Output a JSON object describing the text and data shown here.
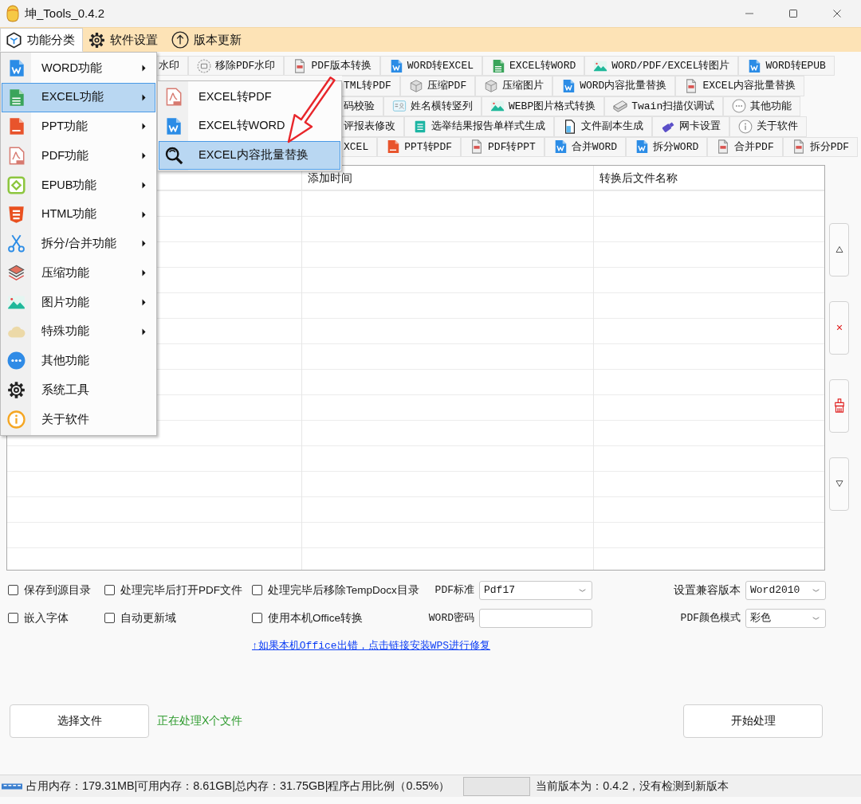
{
  "window": {
    "title": "坤_Tools_0.4.2"
  },
  "menu_bar": [
    {
      "label": "功能分类",
      "kind": "category",
      "selected": true
    },
    {
      "label": "软件设置",
      "kind": "settings",
      "selected": false
    },
    {
      "label": "版本更新",
      "kind": "update",
      "selected": false
    }
  ],
  "category_menu": {
    "items": [
      {
        "label": "WORD功能",
        "kind": "word",
        "has_submenu": true,
        "selected": false
      },
      {
        "label": "EXCEL功能",
        "kind": "excel",
        "has_submenu": true,
        "selected": true,
        "children": [
          {
            "label": "EXCEL转PDF",
            "kind": "pdf",
            "selected": false
          },
          {
            "label": "EXCEL转WORD",
            "kind": "word",
            "selected": false
          },
          {
            "label": "EXCEL内容批量替换",
            "kind": "replace",
            "selected": true
          }
        ]
      },
      {
        "label": "PPT功能",
        "kind": "ppt",
        "has_submenu": true,
        "selected": false
      },
      {
        "label": "PDF功能",
        "kind": "pdf",
        "has_submenu": true,
        "selected": false
      },
      {
        "label": "EPUB功能",
        "kind": "epub",
        "has_submenu": true,
        "selected": false
      },
      {
        "label": "HTML功能",
        "kind": "html",
        "has_submenu": true,
        "selected": false
      },
      {
        "label": "拆分/合并功能",
        "kind": "split",
        "has_submenu": true,
        "selected": false
      },
      {
        "label": "压缩功能",
        "kind": "compress",
        "has_submenu": true,
        "selected": false
      },
      {
        "label": "图片功能",
        "kind": "image",
        "has_submenu": true,
        "selected": false
      },
      {
        "label": "特殊功能",
        "kind": "special",
        "has_submenu": true,
        "selected": false
      },
      {
        "label": "其他功能",
        "kind": "other",
        "has_submenu": false,
        "selected": false
      },
      {
        "label": "系统工具",
        "kind": "system",
        "has_submenu": false,
        "selected": false
      },
      {
        "label": "关于软件",
        "kind": "about",
        "has_submenu": false,
        "selected": false
      }
    ]
  },
  "toolbar_rows": [
    [
      {
        "label": "水印"
      },
      {
        "label": "移除PDF水印",
        "kind": "watermark"
      },
      {
        "label": "PDF版本转换",
        "kind": "graydoc"
      },
      {
        "label": "WORD转EXCEL",
        "kind": "word"
      },
      {
        "label": "EXCEL转WORD",
        "kind": "excel"
      },
      {
        "label": "WORD/PDF/EXCEL转图片",
        "kind": "image"
      },
      {
        "label": "WORD转EPUB",
        "kind": "word"
      }
    ],
    [
      {
        "label": "TML转PDF"
      },
      {
        "label": "压缩PDF",
        "kind": "box"
      },
      {
        "label": "压缩图片",
        "kind": "box"
      },
      {
        "label": "WORD内容批量替换",
        "kind": "word"
      },
      {
        "label": "EXCEL内容批量替换",
        "kind": "graydoc"
      }
    ],
    [
      {
        "label": "码校验"
      },
      {
        "label": "姓名横转竖列",
        "kind": "card"
      },
      {
        "label": "WEBP图片格式转换",
        "kind": "image"
      },
      {
        "label": "Twain扫描仪调试",
        "kind": "scanner"
      },
      {
        "label": "其他功能",
        "kind": "moreline"
      }
    ],
    [
      {
        "label": "评报表修改"
      },
      {
        "label": "选举结果报告单样式生成",
        "kind": "tealdoc"
      },
      {
        "label": "文件副本生成",
        "kind": "file"
      },
      {
        "label": "网卡设置",
        "kind": "usb"
      },
      {
        "label": "关于软件",
        "kind": "infoline"
      }
    ],
    [
      {
        "label": "XCEL"
      },
      {
        "label": "PPT转PDF",
        "kind": "ppt"
      },
      {
        "label": "PDF转PPT",
        "kind": "graydoc"
      },
      {
        "label": "合并WORD",
        "kind": "word"
      },
      {
        "label": "拆分WORD",
        "kind": "word"
      },
      {
        "label": "合并PDF",
        "kind": "graydoc"
      },
      {
        "label": "拆分PDF",
        "kind": "graydoc"
      }
    ]
  ],
  "file_table": {
    "columns": [
      {},
      {
        "heading": "添加时间"
      },
      {
        "heading": "转换后文件名称"
      }
    ]
  },
  "side_buttons": [
    {
      "kind": "move_up"
    },
    {
      "kind": "remove"
    },
    {
      "kind": "clear"
    },
    {
      "kind": "move_down"
    }
  ],
  "options": [
    [
      {
        "kind": "checkbox",
        "label": "保存到源目录",
        "checked": false
      },
      {
        "kind": "checkbox",
        "label": "处理完毕后打开PDF文件",
        "checked": false
      },
      {
        "kind": "checkbox",
        "label": "处理完毕后移除TempDocx目录",
        "checked": false
      },
      {
        "kind": "select",
        "label": "PDF标准",
        "value": "Pdf17"
      },
      {
        "kind": "select",
        "label": "设置兼容版本",
        "value": "Word2010"
      }
    ],
    [
      {
        "kind": "checkbox",
        "label": "嵌入字体",
        "checked": false
      },
      {
        "kind": "checkbox",
        "label": "自动更新域",
        "checked": false
      },
      {
        "kind": "checkbox",
        "label": "使用本机Office转换",
        "checked": false
      },
      {
        "kind": "input",
        "label": "WORD密码"
      },
      {
        "kind": "select",
        "label": "PDF颜色模式",
        "value": "彩色"
      }
    ]
  ],
  "help_link": "↑如果本机Office出错，点击链接安装WPS进行修复",
  "actions": {
    "choose_button": "选择文件",
    "status_text": "正在处理X个文件",
    "start_button": "开始处理"
  },
  "status_bar": {
    "memory": "占用内存：179.31MB|可用内存：8.61GB|总内存：31.75GB|程序占用比例（0.55%）",
    "progress": {
      "level": 0
    },
    "version": "当前版本为：0.4.2，没有检测到新版本"
  }
}
